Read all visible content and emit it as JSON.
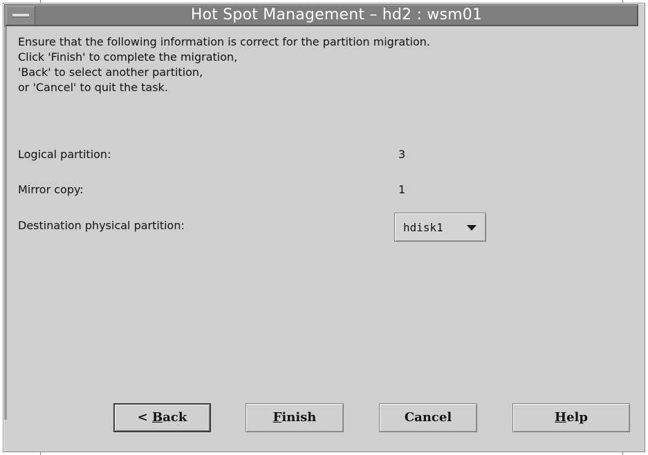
{
  "window": {
    "title": "Hot Spot Management – hd2 : wsm01"
  },
  "message": {
    "lines": [
      "Ensure that the following information is correct for the partition migration.",
      "Click 'Finish' to complete the migration,",
      "'Back' to select another partition,",
      "or 'Cancel' to quit the task."
    ]
  },
  "fields": {
    "logical_partition": {
      "label": "Logical partition:",
      "value": "3"
    },
    "mirror_copy": {
      "label": "Mirror copy:",
      "value": "1"
    },
    "destination": {
      "label": "Destination physical partition:",
      "selected": "hdisk1"
    }
  },
  "buttons": {
    "back": {
      "prefix": "< ",
      "mnemonic": "B",
      "rest": "ack"
    },
    "finish": {
      "mnemonic": "F",
      "rest": "inish"
    },
    "cancel": {
      "label": "Cancel"
    },
    "help": {
      "mnemonic": "H",
      "rest": "elp"
    }
  },
  "icons": {
    "window_menu": "window-menu-icon",
    "dropdown": "triangle-down-icon"
  }
}
